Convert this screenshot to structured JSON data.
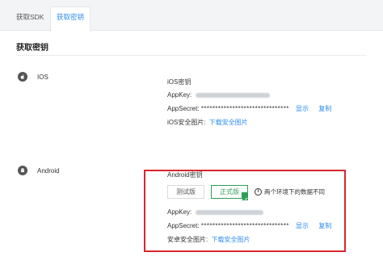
{
  "tabs": [
    {
      "label": "获取SDK"
    },
    {
      "label": "获取密钥"
    }
  ],
  "section_title": "获取密钥",
  "ios": {
    "platform_label": "IOS",
    "block_title": "iOS密钥",
    "appkey_label": "AppKey:",
    "appsecret_label": "AppSecret:",
    "appsecret_mask": "*******************************",
    "show_link": "显示",
    "copy_link": "复制",
    "cert_label": "iOS安全图片:",
    "cert_link": "下载安全图片"
  },
  "android": {
    "platform_label": "Android",
    "block_title": "Android密钥",
    "env_test": "测试版",
    "env_prod": "正式版",
    "env_note": "两个环境下的数据不同",
    "appkey_label": "AppKey:",
    "appsecret_label": "AppSecret:",
    "appsecret_mask": "*******************************",
    "show_link": "显示",
    "copy_link": "复制",
    "cert_label": "安卓安全图片:",
    "cert_link": "下载安全图片"
  },
  "colors": {
    "link": "#2d8cf0",
    "selected_env": "#2f9e55",
    "highlight": "#d8262d"
  }
}
